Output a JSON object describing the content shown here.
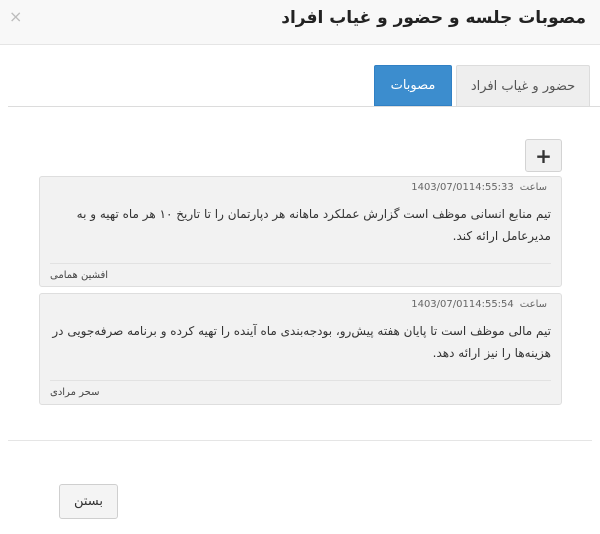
{
  "dialog": {
    "title": "مصوبات جلسه و حضور و غیاب افراد",
    "close_symbol": "×"
  },
  "tabs": [
    {
      "label": "مصوبات",
      "active": true
    },
    {
      "label": "حضور و غیاب افراد",
      "active": false
    }
  ],
  "add_button": {
    "symbol": "+"
  },
  "resolutions": [
    {
      "date": "1403/07/01",
      "time_label": "ساعت",
      "time": "14:55:33",
      "text": "تیم منابع انسانی موظف است گزارش عملکرد ماهانه هر دپارتمان را تا تاریخ ۱۰ هر ماه تهیه و به مدیرعامل ارائه کند.",
      "author": "افشین همامی"
    },
    {
      "date": "1403/07/01",
      "time_label": "ساعت",
      "time": "14:55:54",
      "text": "تیم مالی موظف است تا پایان هفته پیش‌رو، بودجه‌بندی ماه آینده را تهیه کرده و برنامه صرفه‌جویی در هزینه‌ها را نیز ارائه دهد.",
      "author": "سحر مرادی"
    }
  ],
  "footer": {
    "close_label": "بستن"
  },
  "colors": {
    "active_tab": "#3c8dce"
  }
}
